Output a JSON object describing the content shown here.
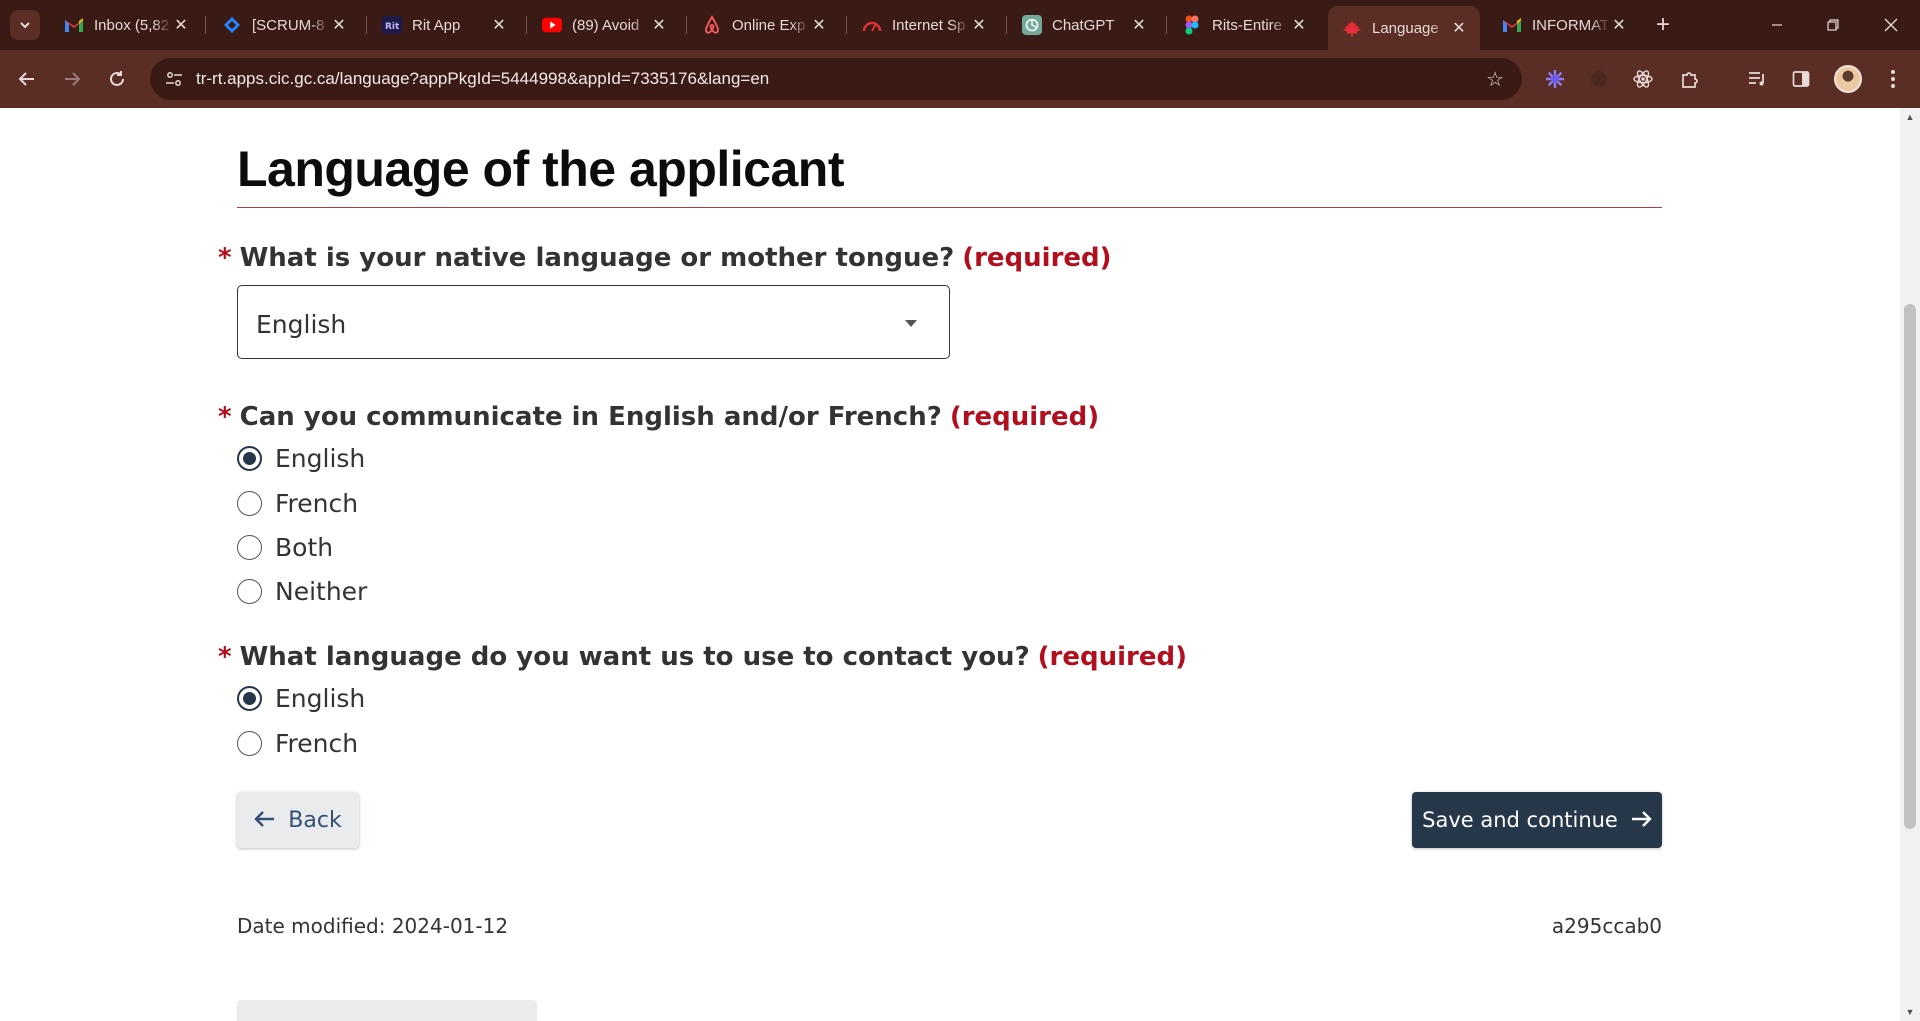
{
  "browser": {
    "tabs": [
      {
        "title": "Inbox (5,82",
        "icon": "gmail-icon"
      },
      {
        "title": "[SCRUM-8",
        "icon": "jira-icon"
      },
      {
        "title": "Rit App",
        "icon": "rit-icon"
      },
      {
        "title": "(89) Avoid",
        "icon": "youtube-icon"
      },
      {
        "title": "Online Exp",
        "icon": "airbnb-icon"
      },
      {
        "title": "Internet Sp",
        "icon": "speedtest-icon"
      },
      {
        "title": "ChatGPT",
        "icon": "chatgpt-icon"
      },
      {
        "title": "Rits-Entire",
        "icon": "figma-icon"
      },
      {
        "title": "Language",
        "icon": "maple-leaf-icon",
        "active": true
      },
      {
        "title": "INFORMAT",
        "icon": "gmail-icon"
      }
    ],
    "close_glyph": "✕",
    "new_tab_glyph": "+",
    "url": "tr-rt.apps.cic.gc.ca/language?appPkgId=5444998&appId=7335176&lang=en"
  },
  "page": {
    "title": "Language of the applicant",
    "required_marker": "*",
    "required_text": "(required)",
    "q1": {
      "label": "What is your native language or mother tongue?",
      "value": "English"
    },
    "q2": {
      "label": "Can you communicate in English and/or French?",
      "options": [
        "English",
        "French",
        "Both",
        "Neither"
      ],
      "selected": "English"
    },
    "q3": {
      "label": "What language do you want us to use to contact you?",
      "options": [
        "English",
        "French"
      ],
      "selected": "English"
    },
    "back_label": "Back",
    "save_label": "Save and continue",
    "date_modified": "Date modified: 2024-01-12",
    "version_code": "a295ccab0"
  },
  "colors": {
    "chrome_dark": "#3a1a14",
    "chrome_toolbar": "#5a2e25",
    "accent_red": "#b10e1e",
    "title_rule": "#af3c43",
    "primary_button": "#26374a",
    "link_blue": "#335075"
  }
}
